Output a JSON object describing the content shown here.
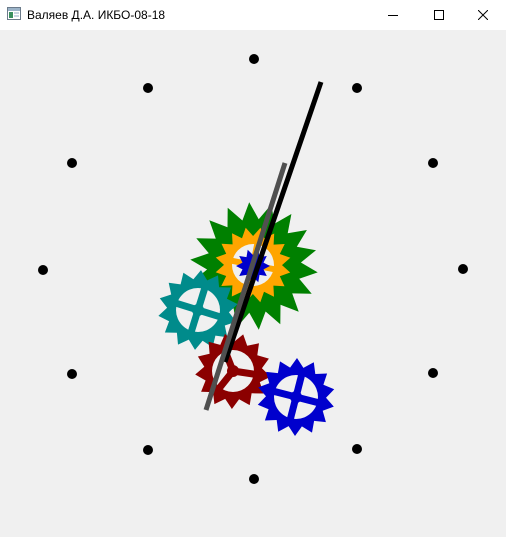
{
  "window": {
    "title": "Валяев Д.А. ИКБО-08-18",
    "icon": "app-window-icon",
    "controls": {
      "minimize": "minimize-icon",
      "maximize": "maximize-icon",
      "close": "close-icon"
    }
  },
  "clock": {
    "hour_marker_count": 12,
    "marker_color": "#000000",
    "hands": [
      {
        "name": "long-hand",
        "color": "#000000"
      },
      {
        "name": "short-hand",
        "color": "#505050"
      }
    ]
  },
  "gears": [
    {
      "name": "green-gear",
      "color": "#008000"
    },
    {
      "name": "orange-gear",
      "color": "#ffa500"
    },
    {
      "name": "teal-gear",
      "color": "#008b8b"
    },
    {
      "name": "dark-red-gear",
      "color": "#8b0000"
    },
    {
      "name": "blue-gear",
      "color": "#0000cd"
    },
    {
      "name": "center-blue-gear",
      "color": "#0000cd"
    }
  ]
}
